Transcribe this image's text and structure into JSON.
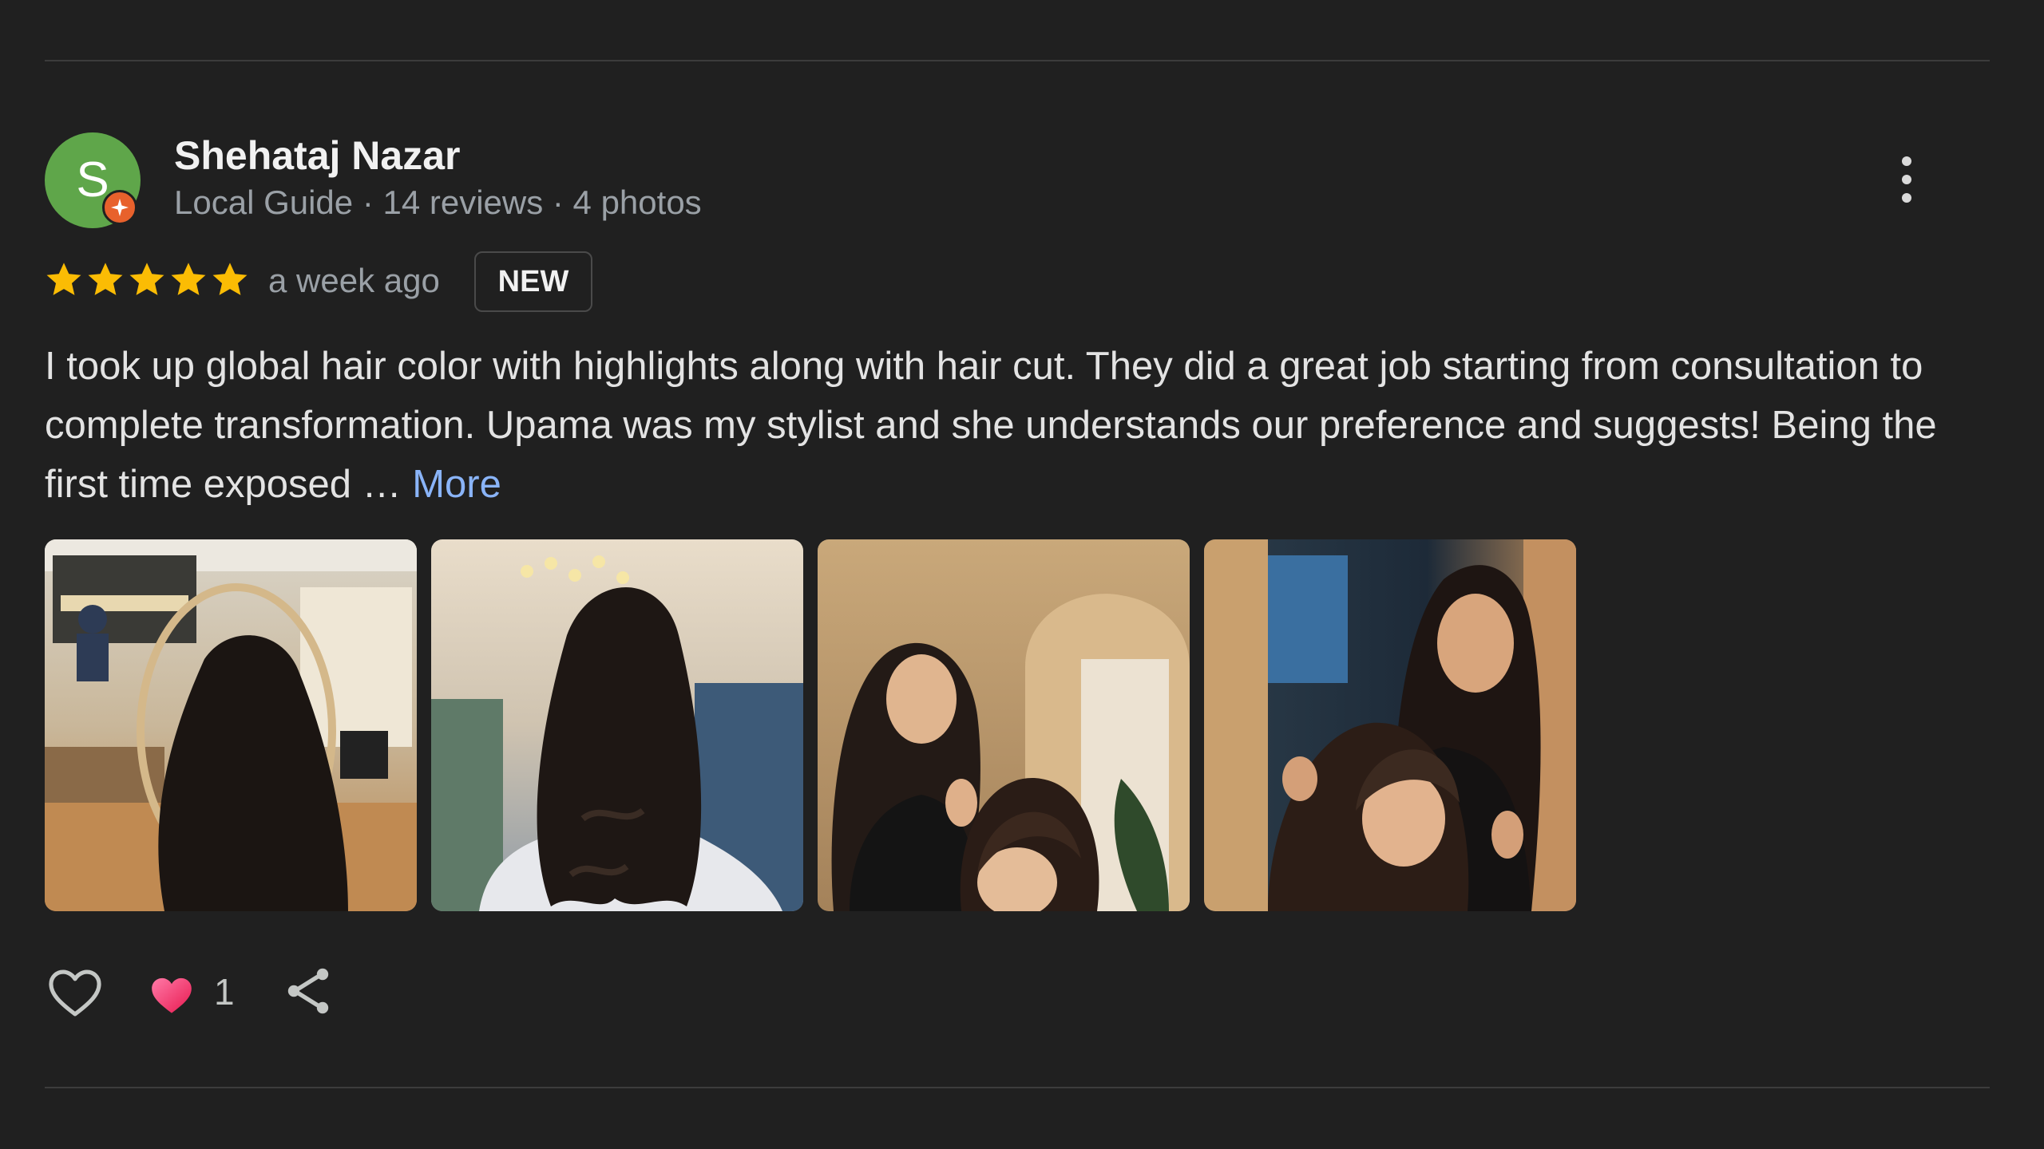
{
  "review": {
    "reviewer": {
      "initial": "S",
      "name": "Shehataj Nazar",
      "meta": "Local Guide · 14 reviews · 4 photos",
      "avatar_color": "#5fa64a",
      "badge_color": "#e8612c"
    },
    "rating": 5,
    "rating_max": 5,
    "star_color": "#fbbc04",
    "timestamp": "a week ago",
    "badge": "NEW",
    "text": "I took up global hair color with highlights along with hair cut. They did a great job starting from consultation to complete transformation. Upama was my stylist and she understands our preference and suggests! Being the first time exposed … ",
    "more_label": "More",
    "link_color": "#8ab4f8",
    "photos_count": 4,
    "reaction": {
      "emoji": "heart",
      "count": "1"
    },
    "icons": {
      "like": "heart-outline-icon",
      "share": "share-icon",
      "menu": "more-vert-icon"
    }
  }
}
